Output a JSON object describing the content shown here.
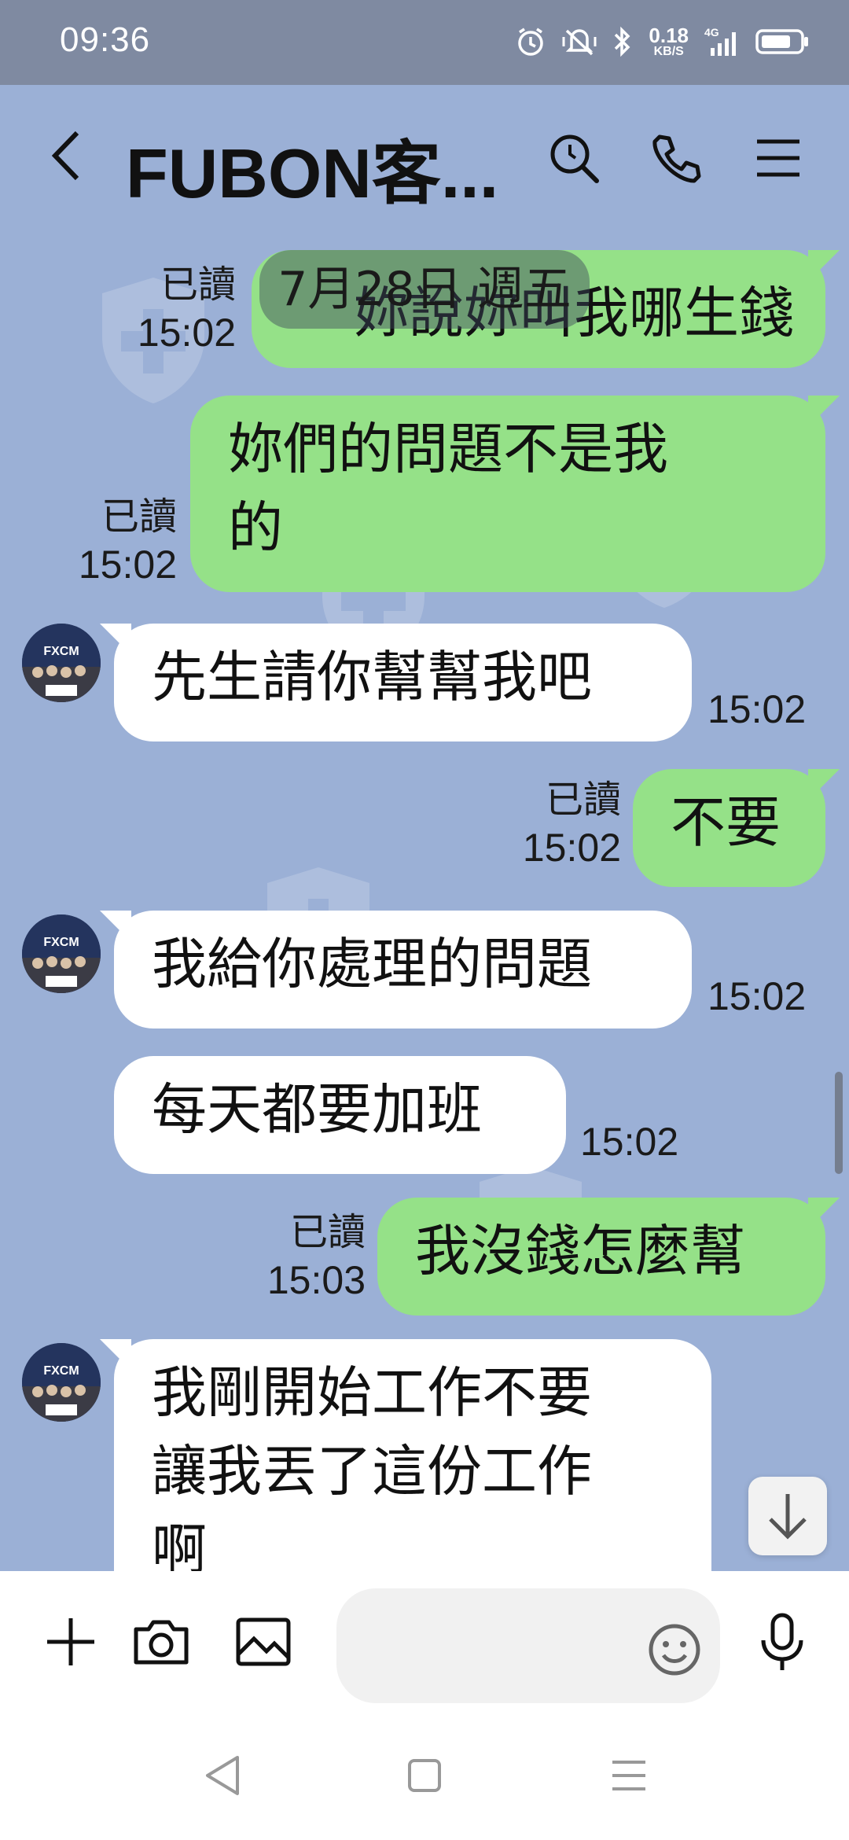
{
  "status_bar": {
    "time": "09:36",
    "net_speed_value": "0.18",
    "net_speed_unit": "KB/S",
    "network": "4G"
  },
  "header": {
    "title": "FUBON客..."
  },
  "chat": {
    "date_chip": "7月28日 週五",
    "messages": [
      {
        "side": "out",
        "text": "妳說妳叫我哪生錢",
        "read": "已讀",
        "time": "15:02"
      },
      {
        "side": "out",
        "text": "妳們的問題不是我\n的",
        "read": "已讀",
        "time": "15:02"
      },
      {
        "side": "in",
        "text": "先生請你幫幫我吧",
        "time": "15:02"
      },
      {
        "side": "out",
        "text": "不要",
        "read": "已讀",
        "time": "15:02"
      },
      {
        "side": "in",
        "text": "我給你處理的問題",
        "time": "15:02"
      },
      {
        "side": "in",
        "text": "每天都要加班",
        "time": "15:02"
      },
      {
        "side": "out",
        "text": "我沒錢怎麼幫",
        "read": "已讀",
        "time": "15:03"
      },
      {
        "side": "in",
        "text": "我剛開始工作不要\n讓我丟了這份工作\n啊",
        "time": ""
      }
    ],
    "avatar_label": "FXCM"
  },
  "colors": {
    "background": "#9bb0d6",
    "outgoing_bubble": "#95e188",
    "incoming_bubble": "#ffffff",
    "status_bar": "#7f8aa1"
  }
}
